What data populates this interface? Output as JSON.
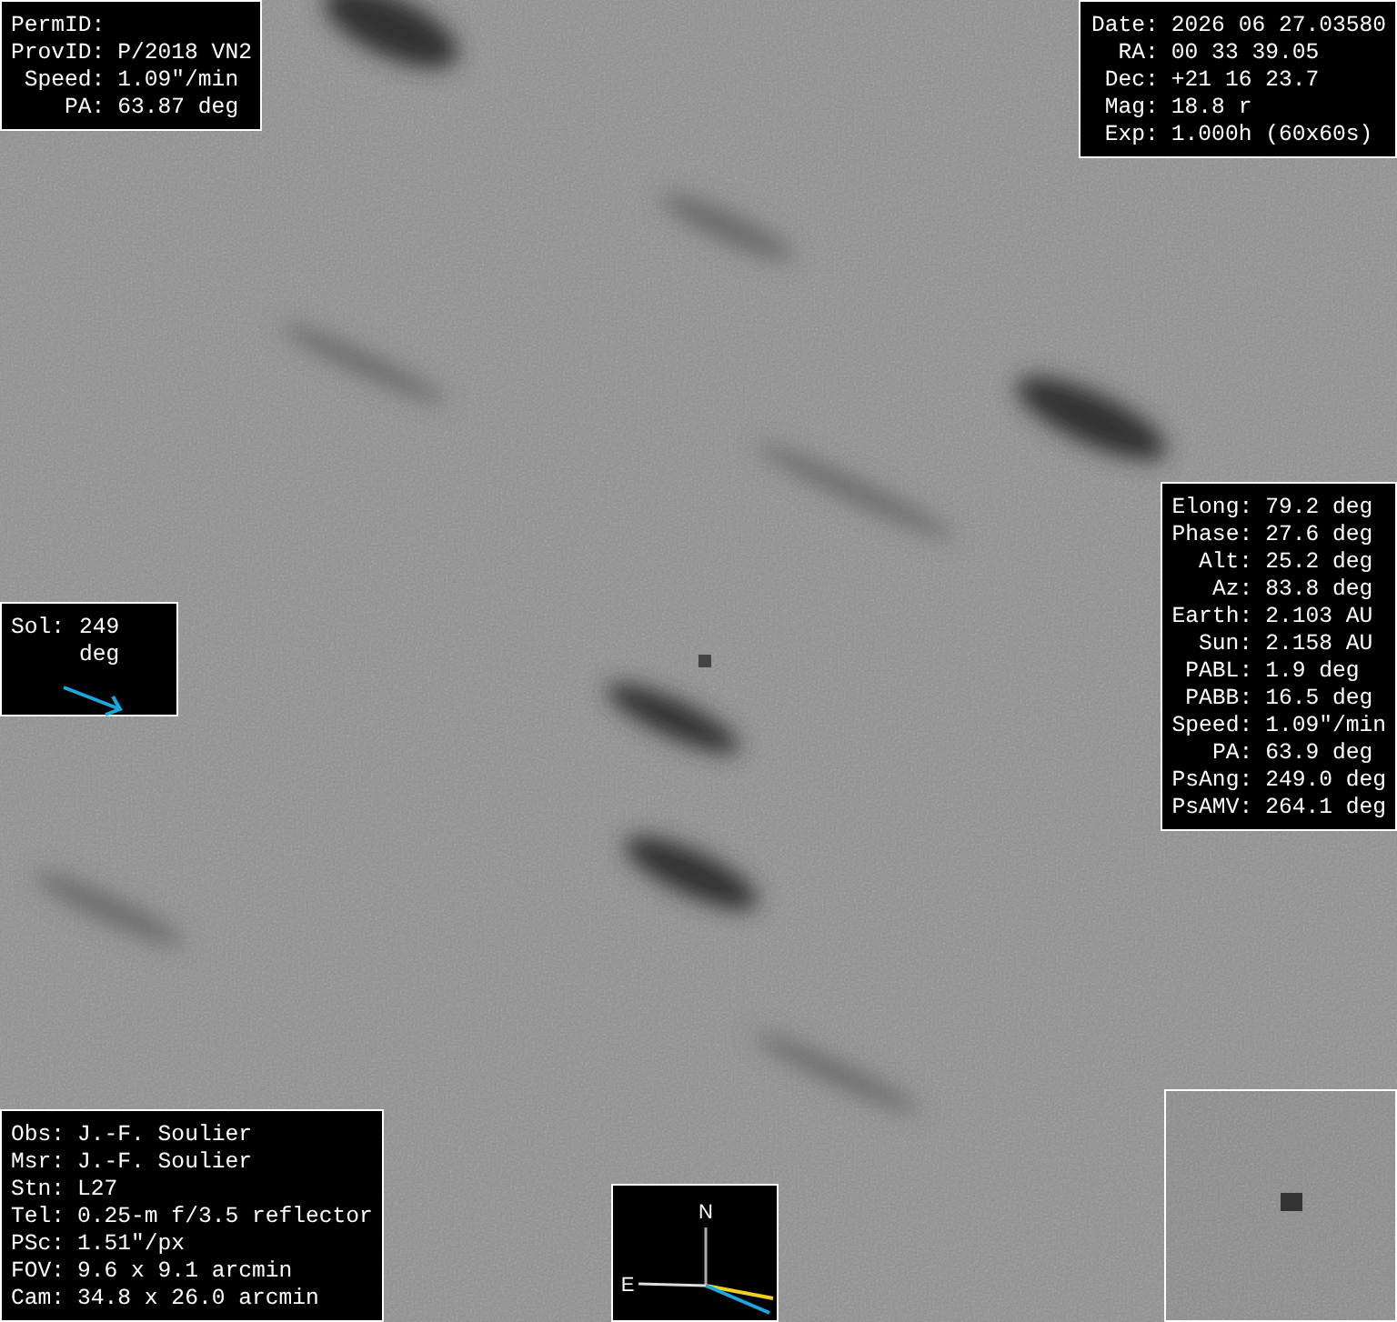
{
  "target_panel": {
    "lines": [
      {
        "label": "PermID:"
      },
      {
        "label": "ProvID:",
        "value": "P/2018 VN2"
      },
      {
        "label": "Speed:",
        "value": "1.09\"/min"
      },
      {
        "label": "PA:",
        "value": "63.87 deg"
      }
    ]
  },
  "observation_panel": {
    "lines": [
      {
        "label": "Date:",
        "value": "2026 06 27.03580"
      },
      {
        "label": "RA:",
        "value": "00 33 39.05"
      },
      {
        "label": "Dec:",
        "value": "+21 16 23.7"
      },
      {
        "label": "Mag:",
        "value": "18.8 r"
      },
      {
        "label": "Exp:",
        "value": "1.000h (60x60s)"
      }
    ]
  },
  "geometry_panel": {
    "lines": [
      {
        "label": "Elong:",
        "value": "79.2 deg"
      },
      {
        "label": "Phase:",
        "value": "27.6 deg"
      },
      {
        "label": "Alt:",
        "value": "25.2 deg"
      },
      {
        "label": "Az:",
        "value": "83.8 deg"
      },
      {
        "label": "Earth:",
        "value": "2.103 AU"
      },
      {
        "label": "Sun:",
        "value": "2.158 AU"
      },
      {
        "label": "PABL:",
        "value": "1.9 deg"
      },
      {
        "label": "PABB:",
        "value": "16.5 deg"
      },
      {
        "label": "Speed:",
        "value": "1.09\"/min"
      },
      {
        "label": "PA:",
        "value": "63.9 deg"
      },
      {
        "label": "PsAng:",
        "value": "249.0 deg"
      },
      {
        "label": "PsAMV:",
        "value": "264.1 deg"
      }
    ]
  },
  "sun_panel": {
    "label": "Sol:",
    "value": "249 deg"
  },
  "observer_panel": {
    "lines": [
      {
        "label": "Obs:",
        "value": "J.-F. Soulier"
      },
      {
        "label": "Msr:",
        "value": "J.-F. Soulier"
      },
      {
        "label": "Stn:",
        "value": "L27"
      },
      {
        "label": "Tel:",
        "value": "0.25-m f/3.5 reflector"
      },
      {
        "label": "PSc:",
        "value": "1.51\"/px"
      },
      {
        "label": "FOV:",
        "value": "9.6 x 9.1 arcmin"
      },
      {
        "label": "Cam:",
        "value": "34.8 x 26.0 arcmin"
      }
    ]
  },
  "compass": {
    "north": "N",
    "east": "E"
  }
}
